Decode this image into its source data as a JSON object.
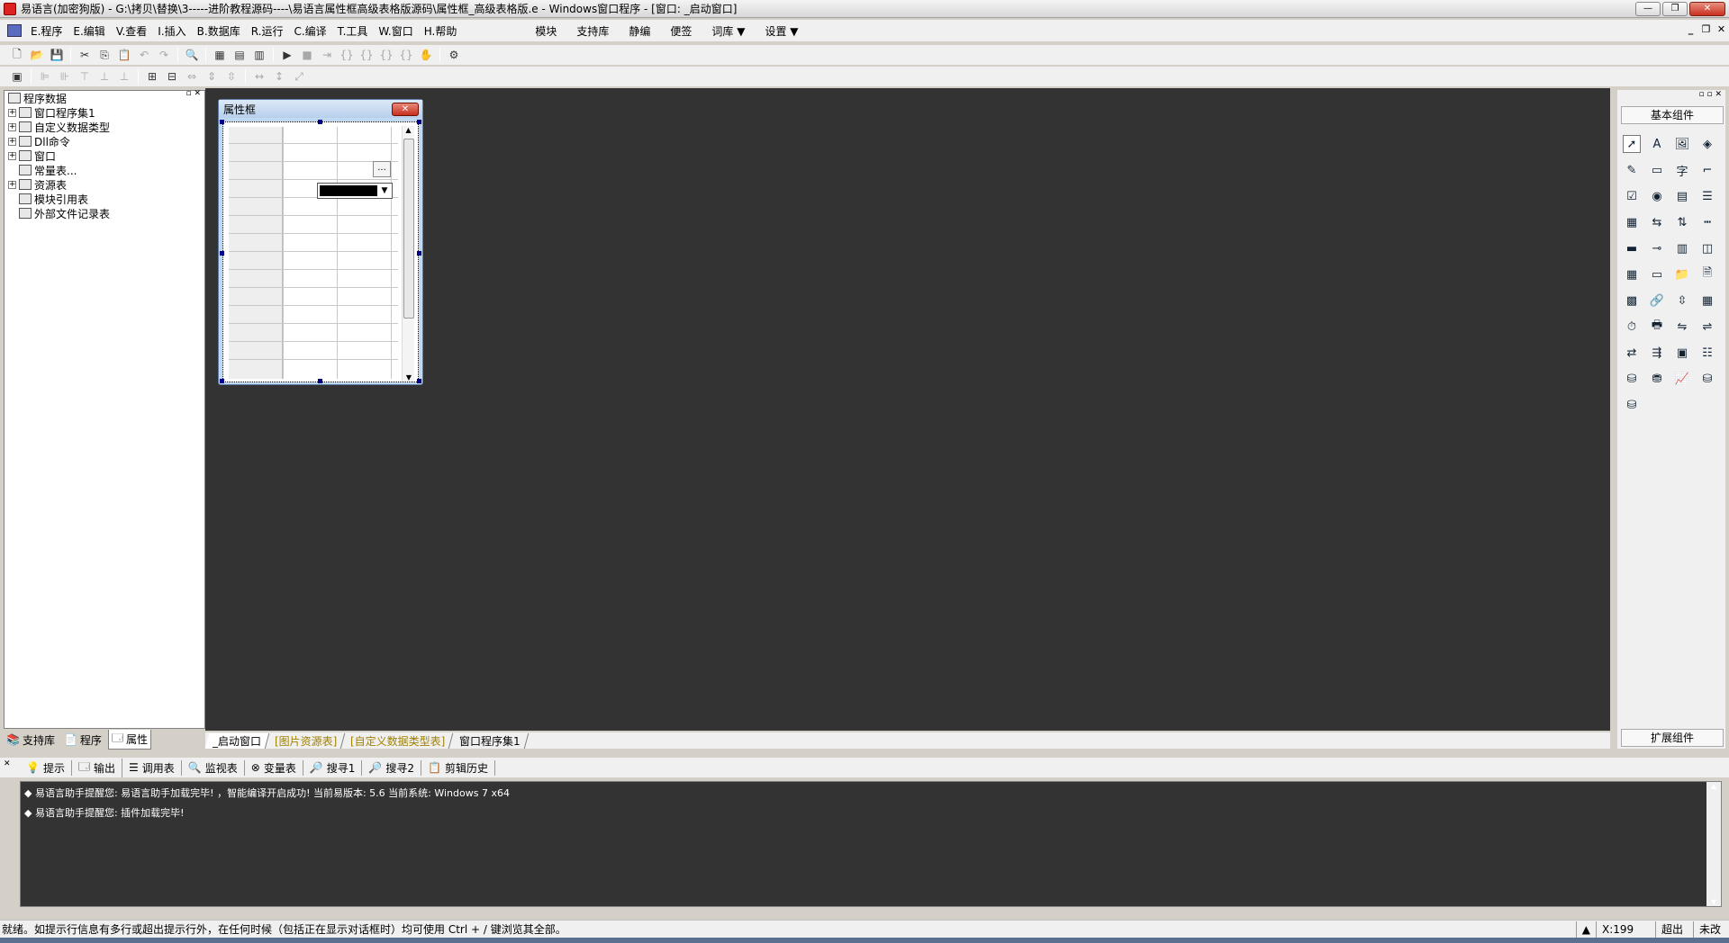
{
  "title": "易语言(加密狗版) - G:\\拷贝\\替换\\3-----进阶教程源码----\\易语言属性框高级表格版源码\\属性框_高级表格版.e - Windows窗口程序 - [窗口: _启动窗口]",
  "window_buttons": {
    "minimize": "—",
    "restore": "❐",
    "close": "✕"
  },
  "menu": [
    "E.程序",
    "E.编辑",
    "V.查看",
    "I.插入",
    "B.数据库",
    "R.运行",
    "C.编译",
    "T.工具",
    "W.窗口",
    "H.帮助"
  ],
  "menu2": [
    "模块",
    "支持库",
    "静编",
    "便签",
    "词库 ▼",
    "设置 ▼"
  ],
  "left_tree": {
    "root": "程序数据",
    "items": [
      {
        "label": "窗口程序集1",
        "expand": true
      },
      {
        "label": "自定义数据类型",
        "expand": true
      },
      {
        "label": "Dll命令",
        "expand": true
      },
      {
        "label": "窗口",
        "expand": true
      },
      {
        "label": "常量表...",
        "expand": false
      },
      {
        "label": "资源表",
        "expand": true
      },
      {
        "label": "模块引用表",
        "expand": false
      },
      {
        "label": "外部文件记录表",
        "expand": false
      }
    ]
  },
  "left_tabs": [
    "支持库",
    "程序",
    "属性"
  ],
  "dialog": {
    "title": "属性框",
    "ellipsis": "...",
    "close": "✕"
  },
  "doc_tabs": [
    "_启动窗口",
    "[图片资源表]",
    "[自定义数据类型表]",
    "窗口程序集1"
  ],
  "right_panel": {
    "header": "基本组件",
    "footer": "扩展组件"
  },
  "output_tabs": [
    "提示",
    "输出",
    "调用表",
    "监视表",
    "变量表",
    "搜寻1",
    "搜寻2",
    "剪辑历史"
  ],
  "output_lines": [
    "◆ 易语言助手提醒您: 易语言助手加载完毕! ，智能编译开启成功! 当前易版本: 5.6  当前系统: Windows 7 x64",
    "◆ 易语言助手提醒您: 插件加载完毕!"
  ],
  "status": {
    "message": "就绪。如提示行信息有多行或超出提示行外，在任何时候（包括正在显示对话框时）均可使用 Ctrl + / 键浏览其全部。",
    "coord": "X:199",
    "mode1": "超出",
    "mode2": "未改"
  }
}
